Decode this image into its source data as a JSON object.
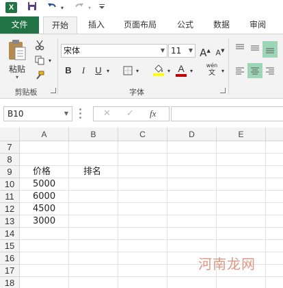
{
  "qat": {
    "app_icon": "excel-logo-icon",
    "app_letter": "X",
    "save_icon": "save-icon",
    "undo_icon": "undo-icon",
    "redo_icon": "redo-icon",
    "customize_icon": "customize-qat-icon"
  },
  "tabs": [
    "文件",
    "开始",
    "插入",
    "页面布局",
    "公式",
    "数据",
    "审阅"
  ],
  "ribbon": {
    "clipboard": {
      "paste_label": "粘贴",
      "group_label": "剪贴板"
    },
    "font": {
      "font_name": "宋体",
      "font_size": "11",
      "bold": "B",
      "italic": "I",
      "underline": "U",
      "grow": "A",
      "shrink": "A",
      "font_color_letter": "A",
      "phonetic": "wén",
      "group_label": "字体"
    }
  },
  "formula_bar": {
    "name_box": "B10",
    "fx_label": "fx",
    "formula": ""
  },
  "grid": {
    "columns": [
      "A",
      "B",
      "C",
      "D",
      "E"
    ],
    "rows": [
      {
        "num": "7",
        "A": "",
        "B": ""
      },
      {
        "num": "8",
        "A": "",
        "B": ""
      },
      {
        "num": "9",
        "A": "价格",
        "B": "排名"
      },
      {
        "num": "10",
        "A": "5000",
        "B": ""
      },
      {
        "num": "11",
        "A": "6000",
        "B": ""
      },
      {
        "num": "12",
        "A": "4500",
        "B": ""
      },
      {
        "num": "13",
        "A": "3000",
        "B": ""
      },
      {
        "num": "14",
        "A": "",
        "B": ""
      },
      {
        "num": "15",
        "A": "",
        "B": ""
      },
      {
        "num": "16",
        "A": "",
        "B": ""
      },
      {
        "num": "17",
        "A": "",
        "B": ""
      },
      {
        "num": "18",
        "A": "",
        "B": ""
      }
    ]
  },
  "watermark": "河南龙网",
  "colors": {
    "brand": "#217346",
    "align_active": "#9fd5b7",
    "highlight_yellow": "#ffff00",
    "font_red": "#c00000"
  }
}
